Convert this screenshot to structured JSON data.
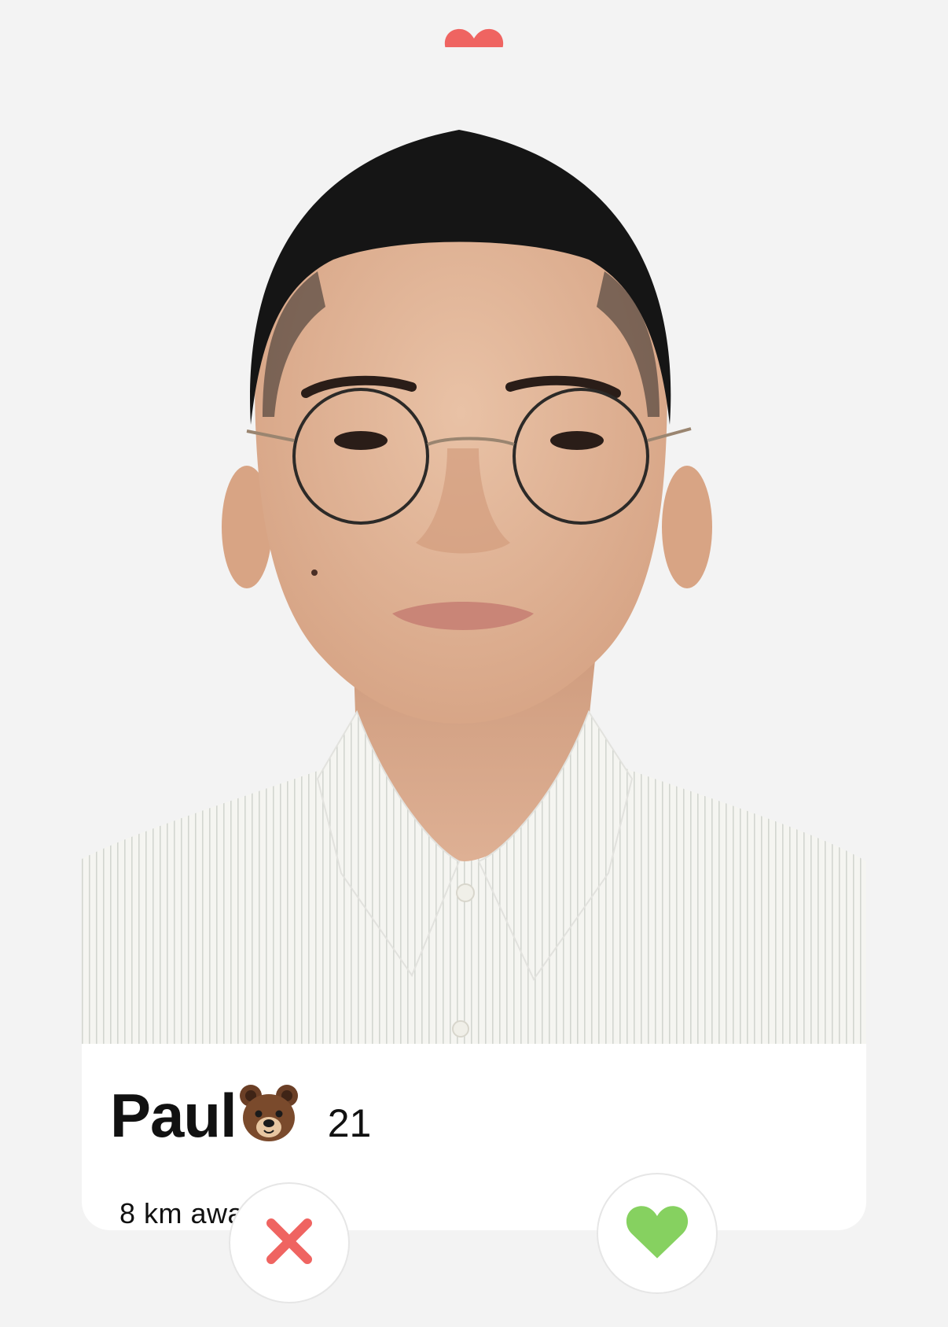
{
  "header": {
    "icon": "heart-icon",
    "icon_color": "#ef6461"
  },
  "profile": {
    "name": "Paul",
    "name_emoji": "🐻",
    "age": "21",
    "distance": "8 km away",
    "photo": "profile-photo"
  },
  "actions": {
    "dislike": {
      "icon": "close-icon",
      "color": "#ef6461"
    },
    "like": {
      "icon": "heart-icon",
      "color": "#86d160"
    }
  },
  "colors": {
    "background": "#f3f3f3",
    "card_panel": "#ffffff",
    "text": "#111111"
  }
}
